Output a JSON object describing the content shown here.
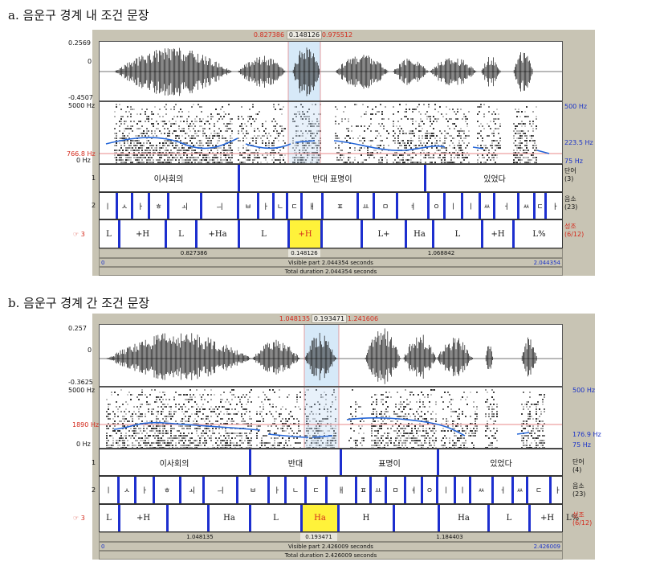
{
  "figures": [
    {
      "title": "a. 음운구 경계 내 조건 문장",
      "selection": {
        "start": "0.827386",
        "duration": "0.148126",
        "end": "0.975512"
      },
      "waveform": {
        "ymax": "0.2569",
        "zero": "0",
        "ymin": "-0.4507"
      },
      "spectrogram": {
        "top_left": "5000 Hz",
        "marker_left": "766.8 Hz",
        "bottom_left": "0 Hz",
        "top_right": "500 Hz",
        "pitch_right": "223.5 Hz",
        "bottom_right": "75 Hz"
      },
      "tiers": [
        {
          "num": "1",
          "name": "단어\n(3)",
          "cells": [
            "이사회의",
            "반대 표명이",
            "있었다"
          ]
        },
        {
          "num": "2",
          "name": "음소\n(23)",
          "cells": [
            "ㅣ",
            "ㅅ",
            "ㅏ",
            "ㅎ",
            "ㅚ",
            "ㅢ",
            "ㅂ",
            "ㅏ",
            "ㄴ",
            "ㄷ",
            "ㅐ",
            "ㅍ",
            "ㅛ",
            "ㅁ",
            "ㅕ",
            "ㅇ",
            "ㅣ",
            "ㅣ",
            "ㅆ",
            "ㅓ",
            "ㅆ",
            "ㄷ",
            "ㅏ"
          ]
        },
        {
          "num": "☞ 3",
          "name": "성조\n(6/12)",
          "cells": [
            "L",
            "+H",
            "L",
            "+Ha",
            "L",
            "+H",
            "",
            "L+",
            "Ha",
            "L",
            "+H",
            "L%"
          ]
        }
      ],
      "bottom": {
        "before": "0.827386",
        "selected": "0.148126",
        "after": "1.068842",
        "left": "0",
        "visible": "Visible part 2.044354 seconds",
        "right": "2.044354",
        "total": "Total duration 2.044354 seconds"
      }
    },
    {
      "title": "b. 음운구 경계 간 조건 문장",
      "selection": {
        "start": "1.048135",
        "duration": "0.193471",
        "end": "1.241606"
      },
      "waveform": {
        "ymax": "0.257",
        "zero": "0",
        "ymin": "-0.3625"
      },
      "spectrogram": {
        "top_left": "5000 Hz",
        "marker_left": "1890 Hz",
        "bottom_left": "0 Hz",
        "top_right": "500 Hz",
        "pitch_right": "176.9 Hz",
        "bottom_right": "75 Hz"
      },
      "tiers": [
        {
          "num": "1",
          "name": "단어\n(4)",
          "cells": [
            "이사회의",
            "반대",
            "표명이",
            "있었다"
          ]
        },
        {
          "num": "2",
          "name": "음소\n(23)",
          "cells": [
            "ㅣ",
            "ㅅ",
            "ㅏ",
            "ㅎ",
            "ㅚ",
            "ㅢ",
            "ㅂ",
            "ㅏ",
            "ㄴ",
            "ㄷ",
            "ㅐ",
            "ㅍ",
            "ㅛ",
            "ㅁ",
            "ㅕ",
            "ㅇ",
            "ㅣ",
            "ㅣ",
            "ㅆ",
            "ㅓ",
            "ㅆ",
            "ㄷ",
            "ㅏ"
          ]
        },
        {
          "num": "☞ 3",
          "name": "성조\n(6/12)",
          "cells": [
            "L",
            "+H",
            "",
            "Ha",
            "L",
            "Ha",
            "H",
            "",
            "Ha",
            "L",
            "+H",
            "L%"
          ]
        }
      ],
      "bottom": {
        "before": "1.048135",
        "selected": "0.193471",
        "after": "1.184403",
        "left": "0",
        "visible": "Visible part 2.426009 seconds",
        "right": "2.426009",
        "total": "Total duration 2.426009 seconds"
      }
    }
  ]
}
